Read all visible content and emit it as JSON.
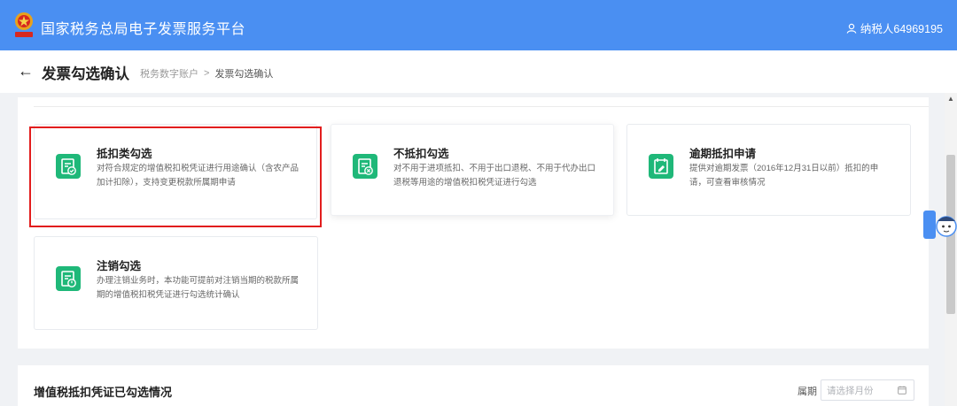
{
  "topbar": {
    "app_title": "国家税务总局电子发票服务平台",
    "user_label": "纳税人64969195",
    "brand_color": "#4a8ff2"
  },
  "header": {
    "back_icon": "←",
    "page_title": "发票勾选确认",
    "breadcrumb": [
      "税务数字账户",
      "发票勾选确认"
    ],
    "breadcrumb_separator": ">"
  },
  "cards": [
    {
      "title": "抵扣类勾选",
      "desc_lines": [
        "对符合规定的增值税扣税凭证进行用途确认（含农产品",
        "加计扣除），支持变更税款所属期申请"
      ],
      "icon": "check-document-icon",
      "highlighted": true
    },
    {
      "title": "不抵扣勾选",
      "desc_lines": [
        "对不用于进项抵扣、不用于出口退税、不用于代办出口",
        "退税等用途的增值税扣税凭证进行勾选"
      ],
      "icon": "cancel-document-icon",
      "highlighted": false
    },
    {
      "title": "逾期抵扣申请",
      "desc_lines": [
        "提供对逾期发票（2016年12月31日以前）抵扣的申",
        "请，可查看审核情况"
      ],
      "icon": "overdue-edit-icon",
      "highlighted": false
    },
    {
      "title": "注销勾选",
      "desc_lines": [
        "办理注销业务时，本功能可提前对注销当期的税款所属",
        "期的增值税扣税凭证进行勾选统计确认"
      ],
      "icon": "power-document-icon",
      "highlighted": false
    }
  ],
  "help_widget": {
    "icon": "help-assistant-icon"
  },
  "bottom": {
    "section_title": "增值税抵扣凭证已勾选情况",
    "period_label": "属期",
    "period_placeholder": "请选择月份"
  },
  "colors": {
    "accent": "#1fb879",
    "highlight": "#e21d1d"
  }
}
